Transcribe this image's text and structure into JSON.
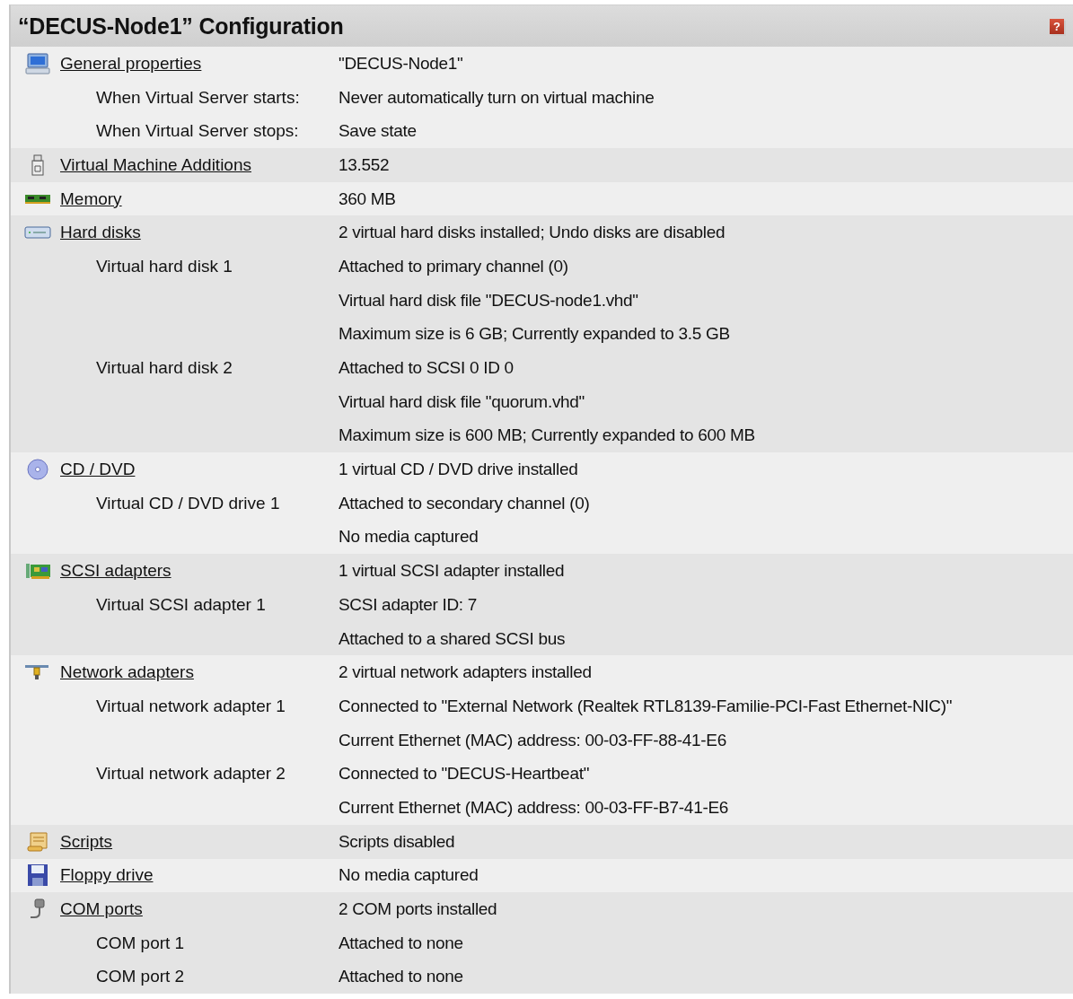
{
  "header": {
    "title": "“DECUS-Node1” Configuration",
    "help_icon": "?"
  },
  "sections": [
    {
      "kind": "computer",
      "label": "General properties",
      "rows": [
        {
          "value": "\"DECUS-Node1\""
        },
        {
          "label": "When Virtual Server starts:",
          "value": "Never automatically turn on virtual machine"
        },
        {
          "label": "When Virtual Server stops:",
          "value": "Save state"
        }
      ]
    },
    {
      "kind": "installer",
      "label": "Virtual Machine Additions",
      "rows": [
        {
          "value": "13.552"
        }
      ]
    },
    {
      "kind": "memory",
      "label": "Memory",
      "rows": [
        {
          "value": "360 MB"
        }
      ]
    },
    {
      "kind": "disk",
      "label": "Hard disks",
      "rows": [
        {
          "value": "2 virtual hard disks installed; Undo disks are disabled"
        },
        {
          "label": "Virtual hard disk 1",
          "value": "Attached to primary channel (0)"
        },
        {
          "value": "Virtual hard disk file \"DECUS-node1.vhd\""
        },
        {
          "value": "Maximum size is 6 GB; Currently expanded to 3.5 GB"
        },
        {
          "label": "Virtual hard disk 2",
          "value": "Attached to SCSI 0 ID 0"
        },
        {
          "value": "Virtual hard disk file \"quorum.vhd\""
        },
        {
          "value": "Maximum size is 600 MB; Currently expanded to 600 MB"
        }
      ]
    },
    {
      "kind": "cd",
      "label": "CD / DVD",
      "rows": [
        {
          "value": "1 virtual CD / DVD drive installed"
        },
        {
          "label": "Virtual CD / DVD drive 1",
          "value": "Attached to secondary channel (0)"
        },
        {
          "value": "No media captured"
        }
      ]
    },
    {
      "kind": "card",
      "label": "SCSI adapters",
      "rows": [
        {
          "value": "1 virtual SCSI adapter installed"
        },
        {
          "label": "Virtual SCSI adapter 1",
          "value": "SCSI adapter ID: 7"
        },
        {
          "value": "Attached to a shared SCSI bus"
        }
      ]
    },
    {
      "kind": "network",
      "label": "Network adapters",
      "rows": [
        {
          "value": "2 virtual network adapters installed"
        },
        {
          "label": "Virtual network adapter 1",
          "value": "Connected to \"External Network (Realtek RTL8139-Familie-PCI-Fast Ethernet-NIC)\""
        },
        {
          "value": "Current Ethernet (MAC) address: 00-03-FF-88-41-E6"
        },
        {
          "label": "Virtual network adapter 2",
          "value": "Connected to \"DECUS-Heartbeat\""
        },
        {
          "value": "Current Ethernet (MAC) address: 00-03-FF-B7-41-E6"
        }
      ]
    },
    {
      "kind": "scroll",
      "label": "Scripts",
      "rows": [
        {
          "value": "Scripts disabled"
        }
      ]
    },
    {
      "kind": "floppy",
      "label": "Floppy drive",
      "rows": [
        {
          "value": "No media captured"
        }
      ]
    },
    {
      "kind": "plug",
      "label": "COM ports",
      "rows": [
        {
          "value": "2 COM ports installed"
        },
        {
          "label": "COM port 1",
          "value": "Attached to none"
        },
        {
          "label": "COM port 2",
          "value": "Attached to none"
        }
      ]
    }
  ]
}
